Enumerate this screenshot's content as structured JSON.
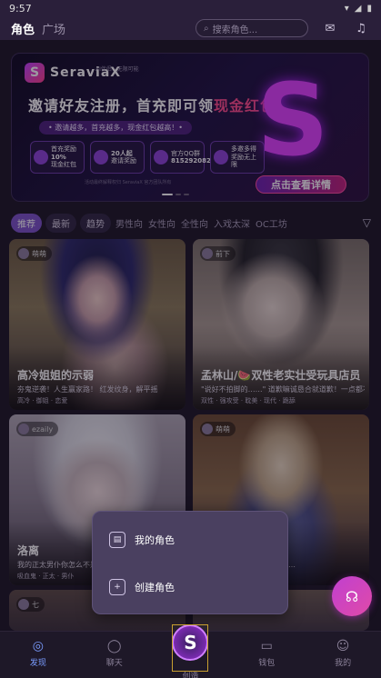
{
  "status_bar": {
    "time": "9:57",
    "icons": [
      "wifi-icon",
      "signal-icon",
      "battery-icon"
    ]
  },
  "top_nav": {
    "tabs": [
      {
        "label": "角色",
        "active": true
      },
      {
        "label": "广场",
        "active": false
      }
    ],
    "search_placeholder": "搜索角色..."
  },
  "banner": {
    "brand": "SeraviaX",
    "tagline": "AI伴侣 · 无限可能",
    "headline_a": "邀请好友注册，首充即可领",
    "headline_b": "现金红包！",
    "sub": "• 邀请越多，首充越多，现金红包越高！•",
    "badges": [
      {
        "line1": "首充奖励",
        "line2": "10%",
        "line3": "现金红包"
      },
      {
        "line1": "20人起",
        "line2": "邀请奖励",
        "line3": ""
      },
      {
        "line1": "官方QQ群",
        "line2": "815292082",
        "line3": ""
      },
      {
        "line1": "多邀多得",
        "line2": "奖励无上限",
        "line3": ""
      }
    ],
    "footnote": "活动最终解释权归 SeraviaX 官方团队所有",
    "cta": "点击查看详情"
  },
  "filters": [
    {
      "label": "推荐",
      "style": "active"
    },
    {
      "label": "最新",
      "style": "pill"
    },
    {
      "label": "趋势",
      "style": "pill"
    },
    {
      "label": "男性向",
      "style": "plain"
    },
    {
      "label": "女性向",
      "style": "plain"
    },
    {
      "label": "全性向",
      "style": "plain"
    },
    {
      "label": "入戏太深",
      "style": "plain"
    },
    {
      "label": "OC工坊",
      "style": "plain"
    }
  ],
  "cards": [
    {
      "author": "萌萌",
      "title": "高冷姐姐的示弱",
      "desc": "夯鬼逆袭！人生赢家路！ 红发纹身，解平摇",
      "tags": "高冷 · 御姐 · 恋爱"
    },
    {
      "author": "前下",
      "title": "孟林山/🍉双性老实壮受玩具店员",
      "desc": "\"说好不拍脚的……\" 道歉嘛诚恳合就道歉！一点都不…",
      "tags": "双性 · 强攻受 · 耽美 · 现代 · 跪舔"
    },
    {
      "author": "ezaily",
      "title": "洛离",
      "desc": "我的正太男仆你怎么不是个…",
      "tags": "吸血鬼 · 正太 · 男仆"
    },
    {
      "author": "萌萌",
      "title": "我来说你的",
      "desc": "在这个世界打败我你还不能…",
      "tags": ""
    },
    {
      "author": "七",
      "title": "",
      "desc": "",
      "tags": ""
    },
    {
      "author": "",
      "title": "",
      "desc": "",
      "tags": ""
    }
  ],
  "popup": {
    "items": [
      {
        "label": "我的角色",
        "icon": "id-card-icon"
      },
      {
        "label": "创建角色",
        "icon": "add-user-icon"
      }
    ]
  },
  "fab": {
    "icon": "headset-icon"
  },
  "bottom_nav": [
    {
      "label": "发现",
      "icon": "compass-icon",
      "active": true
    },
    {
      "label": "聊天",
      "icon": "chat-icon",
      "active": false
    },
    {
      "label": "创造",
      "icon": "create-icon",
      "active": false
    },
    {
      "label": "钱包",
      "icon": "wallet-icon",
      "active": false
    },
    {
      "label": "我的",
      "icon": "profile-icon",
      "active": false
    }
  ],
  "colors": {
    "accent": "#7a52c8",
    "brand_pink": "#ff4a8c",
    "nav_active": "#7a9cff"
  }
}
